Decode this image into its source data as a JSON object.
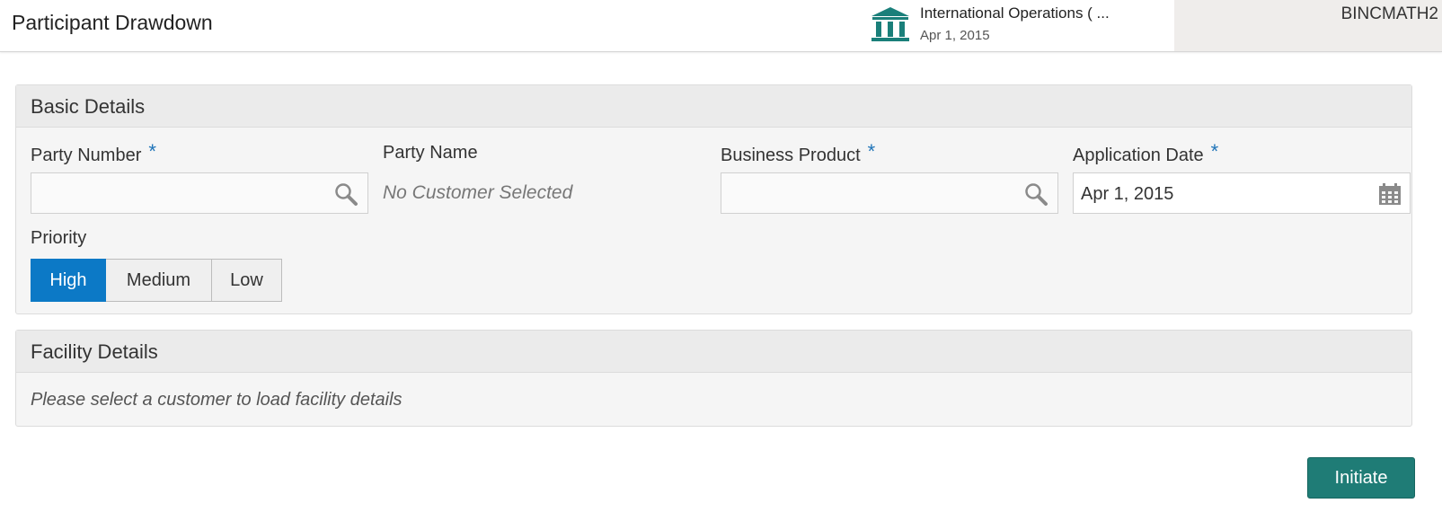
{
  "header": {
    "title": "Participant Drawdown",
    "branch_name": "International Operations ( ...",
    "branch_date": "Apr 1, 2015",
    "user": "BINCMATH2",
    "branch_icon": "bank-icon"
  },
  "basic_details": {
    "title": "Basic Details",
    "party_number_label": "Party Number",
    "party_number_value": "",
    "party_name_label": "Party Name",
    "party_name_value": "No Customer Selected",
    "business_product_label": "Business Product",
    "business_product_value": "",
    "application_date_label": "Application Date",
    "application_date_value": "Apr 1, 2015",
    "required_mark": "*",
    "priority_label": "Priority",
    "priority_options": [
      "High",
      "Medium",
      "Low"
    ],
    "priority_selected": "High"
  },
  "facility_details": {
    "title": "Facility Details",
    "message": "Please select a customer to load facility details"
  },
  "actions": {
    "initiate_label": "Initiate"
  },
  "colors": {
    "accent": "#0c79c6",
    "primary_button": "#1f7c76",
    "required": "#1e73b8",
    "icon_teal": "#1a7f7a"
  }
}
